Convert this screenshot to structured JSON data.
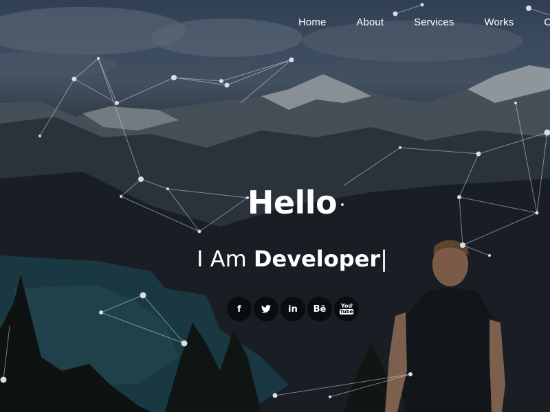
{
  "nav": {
    "items": [
      {
        "label": "Home",
        "active": true
      },
      {
        "label": "About",
        "active": false
      },
      {
        "label": "Services",
        "active": false
      },
      {
        "label": "Works",
        "active": false
      },
      {
        "label": "C",
        "active": false
      }
    ]
  },
  "hero": {
    "title": "Hello",
    "subtitle_prefix": "I Am ",
    "subtitle_role": "Developer",
    "cursor": "|"
  },
  "social": [
    {
      "icon": "facebook-icon",
      "glyph": "f"
    },
    {
      "icon": "twitter-icon",
      "glyph": ""
    },
    {
      "icon": "linkedin-icon",
      "glyph": "in"
    },
    {
      "icon": "behance-icon",
      "glyph": "Bē"
    },
    {
      "icon": "youtube-icon",
      "glyph": "You\nTube"
    }
  ],
  "colors": {
    "text": "#ffffff",
    "network_line": "#cfd6de",
    "social_bg": "#000000"
  }
}
